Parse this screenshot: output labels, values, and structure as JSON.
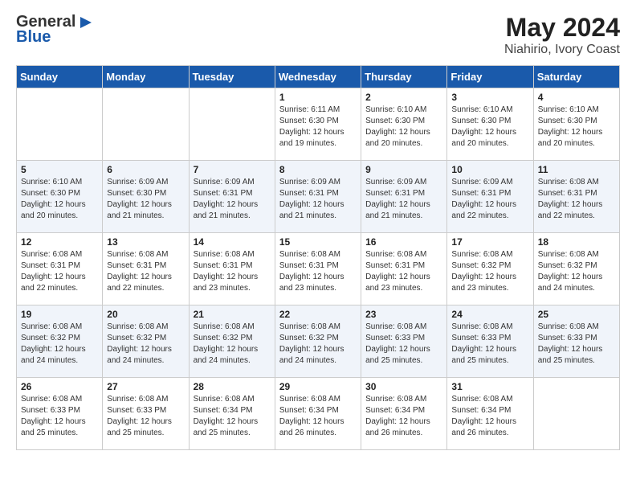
{
  "logo": {
    "general": "General",
    "blue": "Blue"
  },
  "title": "May 2024",
  "subtitle": "Niahirio, Ivory Coast",
  "weekdays": [
    "Sunday",
    "Monday",
    "Tuesday",
    "Wednesday",
    "Thursday",
    "Friday",
    "Saturday"
  ],
  "weeks": [
    [
      {
        "day": "",
        "info": ""
      },
      {
        "day": "",
        "info": ""
      },
      {
        "day": "",
        "info": ""
      },
      {
        "day": "1",
        "info": "Sunrise: 6:11 AM\nSunset: 6:30 PM\nDaylight: 12 hours\nand 19 minutes."
      },
      {
        "day": "2",
        "info": "Sunrise: 6:10 AM\nSunset: 6:30 PM\nDaylight: 12 hours\nand 20 minutes."
      },
      {
        "day": "3",
        "info": "Sunrise: 6:10 AM\nSunset: 6:30 PM\nDaylight: 12 hours\nand 20 minutes."
      },
      {
        "day": "4",
        "info": "Sunrise: 6:10 AM\nSunset: 6:30 PM\nDaylight: 12 hours\nand 20 minutes."
      }
    ],
    [
      {
        "day": "5",
        "info": "Sunrise: 6:10 AM\nSunset: 6:30 PM\nDaylight: 12 hours\nand 20 minutes."
      },
      {
        "day": "6",
        "info": "Sunrise: 6:09 AM\nSunset: 6:30 PM\nDaylight: 12 hours\nand 21 minutes."
      },
      {
        "day": "7",
        "info": "Sunrise: 6:09 AM\nSunset: 6:31 PM\nDaylight: 12 hours\nand 21 minutes."
      },
      {
        "day": "8",
        "info": "Sunrise: 6:09 AM\nSunset: 6:31 PM\nDaylight: 12 hours\nand 21 minutes."
      },
      {
        "day": "9",
        "info": "Sunrise: 6:09 AM\nSunset: 6:31 PM\nDaylight: 12 hours\nand 21 minutes."
      },
      {
        "day": "10",
        "info": "Sunrise: 6:09 AM\nSunset: 6:31 PM\nDaylight: 12 hours\nand 22 minutes."
      },
      {
        "day": "11",
        "info": "Sunrise: 6:08 AM\nSunset: 6:31 PM\nDaylight: 12 hours\nand 22 minutes."
      }
    ],
    [
      {
        "day": "12",
        "info": "Sunrise: 6:08 AM\nSunset: 6:31 PM\nDaylight: 12 hours\nand 22 minutes."
      },
      {
        "day": "13",
        "info": "Sunrise: 6:08 AM\nSunset: 6:31 PM\nDaylight: 12 hours\nand 22 minutes."
      },
      {
        "day": "14",
        "info": "Sunrise: 6:08 AM\nSunset: 6:31 PM\nDaylight: 12 hours\nand 23 minutes."
      },
      {
        "day": "15",
        "info": "Sunrise: 6:08 AM\nSunset: 6:31 PM\nDaylight: 12 hours\nand 23 minutes."
      },
      {
        "day": "16",
        "info": "Sunrise: 6:08 AM\nSunset: 6:31 PM\nDaylight: 12 hours\nand 23 minutes."
      },
      {
        "day": "17",
        "info": "Sunrise: 6:08 AM\nSunset: 6:32 PM\nDaylight: 12 hours\nand 23 minutes."
      },
      {
        "day": "18",
        "info": "Sunrise: 6:08 AM\nSunset: 6:32 PM\nDaylight: 12 hours\nand 24 minutes."
      }
    ],
    [
      {
        "day": "19",
        "info": "Sunrise: 6:08 AM\nSunset: 6:32 PM\nDaylight: 12 hours\nand 24 minutes."
      },
      {
        "day": "20",
        "info": "Sunrise: 6:08 AM\nSunset: 6:32 PM\nDaylight: 12 hours\nand 24 minutes."
      },
      {
        "day": "21",
        "info": "Sunrise: 6:08 AM\nSunset: 6:32 PM\nDaylight: 12 hours\nand 24 minutes."
      },
      {
        "day": "22",
        "info": "Sunrise: 6:08 AM\nSunset: 6:32 PM\nDaylight: 12 hours\nand 24 minutes."
      },
      {
        "day": "23",
        "info": "Sunrise: 6:08 AM\nSunset: 6:33 PM\nDaylight: 12 hours\nand 25 minutes."
      },
      {
        "day": "24",
        "info": "Sunrise: 6:08 AM\nSunset: 6:33 PM\nDaylight: 12 hours\nand 25 minutes."
      },
      {
        "day": "25",
        "info": "Sunrise: 6:08 AM\nSunset: 6:33 PM\nDaylight: 12 hours\nand 25 minutes."
      }
    ],
    [
      {
        "day": "26",
        "info": "Sunrise: 6:08 AM\nSunset: 6:33 PM\nDaylight: 12 hours\nand 25 minutes."
      },
      {
        "day": "27",
        "info": "Sunrise: 6:08 AM\nSunset: 6:33 PM\nDaylight: 12 hours\nand 25 minutes."
      },
      {
        "day": "28",
        "info": "Sunrise: 6:08 AM\nSunset: 6:34 PM\nDaylight: 12 hours\nand 25 minutes."
      },
      {
        "day": "29",
        "info": "Sunrise: 6:08 AM\nSunset: 6:34 PM\nDaylight: 12 hours\nand 26 minutes."
      },
      {
        "day": "30",
        "info": "Sunrise: 6:08 AM\nSunset: 6:34 PM\nDaylight: 12 hours\nand 26 minutes."
      },
      {
        "day": "31",
        "info": "Sunrise: 6:08 AM\nSunset: 6:34 PM\nDaylight: 12 hours\nand 26 minutes."
      },
      {
        "day": "",
        "info": ""
      }
    ]
  ]
}
